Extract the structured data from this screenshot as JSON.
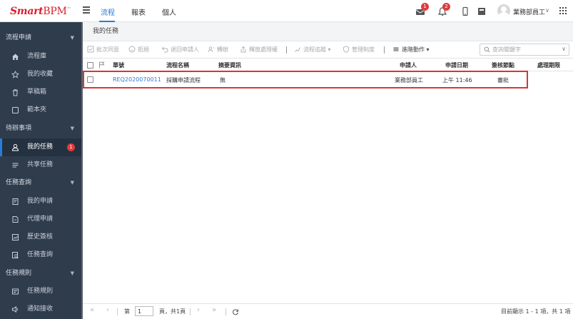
{
  "app": {
    "logo_main": "Smart",
    "logo_suffix": "BPM",
    "logo_tm": "™"
  },
  "top_nav": {
    "items": [
      {
        "label": "流程",
        "active": true
      },
      {
        "label": "報表",
        "active": false
      },
      {
        "label": "個人",
        "active": false
      }
    ]
  },
  "top_right": {
    "mail_badge": "1",
    "bell_badge": "2",
    "user_name": "業務部員工",
    "user_caret": "∨"
  },
  "sidebar": {
    "groups": [
      {
        "label": "流程申請",
        "items": [
          {
            "label": "流程庫",
            "icon": "home-icon"
          },
          {
            "label": "我的收藏",
            "icon": "star-icon"
          },
          {
            "label": "草稿箱",
            "icon": "trash-icon"
          },
          {
            "label": "範本夾",
            "icon": "square-icon"
          }
        ]
      },
      {
        "label": "待辦事項",
        "items": [
          {
            "label": "我的任務",
            "icon": "user-icon",
            "badge": "1",
            "active": true
          },
          {
            "label": "共享任務",
            "icon": "list-icon"
          }
        ]
      },
      {
        "label": "任務查詢",
        "items": [
          {
            "label": "我的申請",
            "icon": "doc-edit-icon"
          },
          {
            "label": "代理申請",
            "icon": "doc-icon"
          },
          {
            "label": "歷史簽核",
            "icon": "history-icon"
          },
          {
            "label": "任務查詢",
            "icon": "search-doc-icon"
          }
        ]
      },
      {
        "label": "任務規則",
        "items": [
          {
            "label": "任務規則",
            "icon": "rule-icon"
          },
          {
            "label": "通知接收",
            "icon": "speaker-icon"
          }
        ]
      }
    ]
  },
  "main": {
    "breadcrumb": "我的任務",
    "toolbar": {
      "batch_approve": "批次同意",
      "reject": "拒絕",
      "return_applicant": "退回申請人",
      "transfer": "轉辦",
      "release_handler": "釋放處理權",
      "flow_trace": "流程追蹤",
      "management": "管理制度",
      "advanced": "進階動作",
      "search_placeholder": "查詢關鍵字"
    },
    "table": {
      "headers": {
        "form_no": "單號",
        "flow_name": "流程名稱",
        "summary": "摘要資訊",
        "applicant": "申請人",
        "apply_date": "申請日期",
        "node": "簽核節點",
        "deadline": "處理期限"
      },
      "rows": [
        {
          "form_no": "REQ2020070011",
          "flow_name": "採購申請流程",
          "summary": "無",
          "applicant": "業務部員工",
          "apply_date": "上午 11:46",
          "node": "審批",
          "deadline": ""
        }
      ]
    },
    "pager": {
      "page_prefix": "第",
      "page_value": "1",
      "page_suffix": "頁，共1頁",
      "summary": "目前顯示 1 - 1 項，共 1 項"
    }
  },
  "colors": {
    "accent": "#2b7cd9",
    "sidebar_bg": "#2f3c4c",
    "badge": "#e23b3b",
    "logo": "#d81e2c",
    "highlight_outline": "#d93535"
  }
}
